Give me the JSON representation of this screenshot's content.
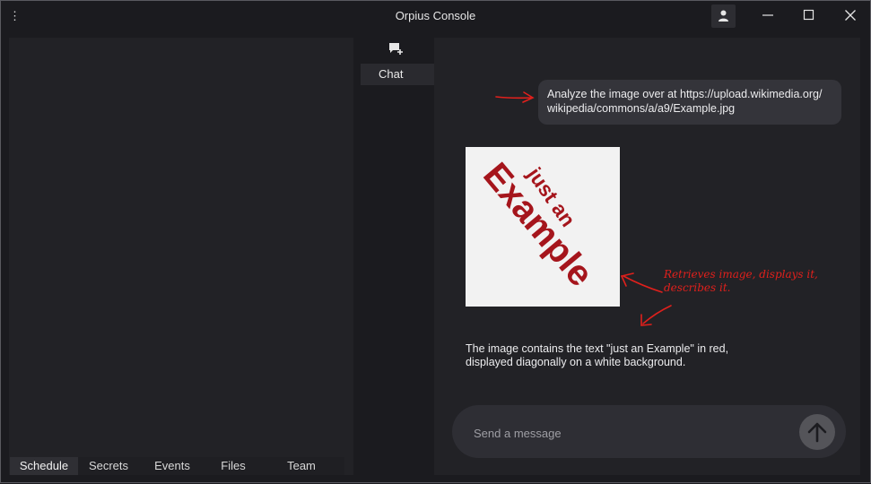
{
  "window": {
    "title": "Orpius Console"
  },
  "sidebar": {
    "tabs": [
      {
        "label": "Schedule",
        "active": true
      },
      {
        "label": "Secrets"
      },
      {
        "label": "Events"
      },
      {
        "label": "Files"
      },
      {
        "label": "Team"
      }
    ]
  },
  "rail": {
    "chat_label": "Chat"
  },
  "chat": {
    "user_message_line1": "Analyze the image over at https://upload.wikimedia.org/",
    "user_message_line2": "wikipedia/commons/a/a9/Example.jpg",
    "image_text_1": "just an",
    "image_text_2": "Example",
    "reply_line1": "The image contains the text \"just an Example\" in red,",
    "reply_line2": "displayed diagonally on a white background.",
    "input_placeholder": "Send a message"
  },
  "annotation": {
    "line1": "Retrieves image, displays it,",
    "line2": "describes it.",
    "color": "#e0201c"
  },
  "colors": {
    "background": "#1b1b1f",
    "panel": "#222226",
    "bubble": "#34343a",
    "accent_red": "#e0201c",
    "image_text": "#a5151c"
  }
}
